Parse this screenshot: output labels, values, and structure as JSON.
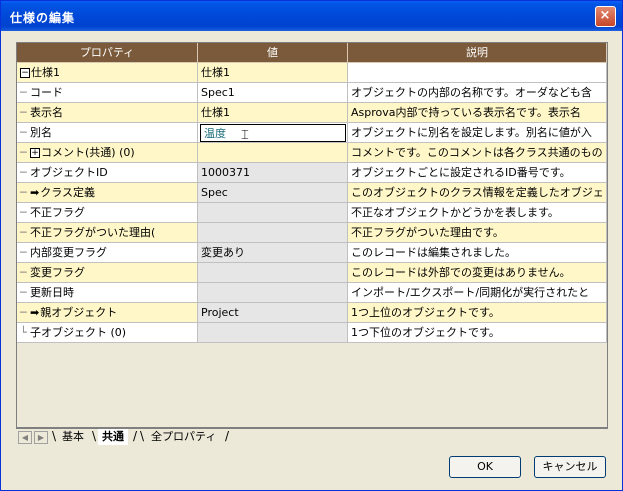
{
  "window": {
    "title": "仕様の編集",
    "close_label": "×"
  },
  "grid": {
    "headers": [
      "プロパティ",
      "値",
      "説明"
    ],
    "rows": [
      {
        "prefix": "",
        "expander": "−",
        "arrow": "",
        "label": "仕様1",
        "value": "仕様1",
        "desc": "",
        "c1": "yellow",
        "c2": "yellow",
        "c3": "white"
      },
      {
        "prefix": "─",
        "expander": "",
        "arrow": "",
        "label": "コード",
        "value": "Spec1",
        "desc": "オブジェクトの内部の名称です。オーダなども含",
        "c1": "white",
        "c2": "white",
        "c3": "white"
      },
      {
        "prefix": "─",
        "expander": "",
        "arrow": "",
        "label": "表示名",
        "value": "仕様1",
        "desc": "Asprova内部で持っている表示名です。表示名",
        "c1": "yellow",
        "c2": "yellow",
        "c3": "yellow"
      },
      {
        "prefix": "─",
        "expander": "",
        "arrow": "",
        "label": "別名",
        "value": "温度",
        "desc": "オブジェクトに別名を設定します。別名に値が入",
        "c1": "white",
        "c2": "white",
        "c3": "white",
        "editing": true
      },
      {
        "prefix": "─",
        "expander": "+",
        "arrow": "",
        "label": "コメント(共通) (0)",
        "value": "",
        "desc": "コメントです。このコメントは各クラス共通のもの",
        "c1": "yellow",
        "c2": "yellow",
        "c3": "yellow"
      },
      {
        "prefix": "─",
        "expander": "",
        "arrow": "",
        "label": "オブジェクトID",
        "value": "1000371",
        "desc": "オブジェクトごとに設定されるID番号です。",
        "c1": "white",
        "c2": "gray",
        "c3": "white"
      },
      {
        "prefix": "─",
        "expander": "",
        "arrow": "➡",
        "label": "クラス定義",
        "value": "Spec",
        "desc": "このオブジェクトのクラス情報を定義したオブジェ",
        "c1": "yellow",
        "c2": "gray",
        "c3": "yellow"
      },
      {
        "prefix": "─",
        "expander": "",
        "arrow": "",
        "label": "不正フラグ",
        "value": "",
        "desc": "不正なオブジェクトかどうかを表します。",
        "c1": "white",
        "c2": "gray",
        "c3": "white"
      },
      {
        "prefix": "─",
        "expander": "",
        "arrow": "",
        "label": "不正フラグがついた理由(",
        "value": "",
        "desc": "不正フラグがついた理由です。",
        "c1": "yellow",
        "c2": "gray",
        "c3": "yellow"
      },
      {
        "prefix": "─",
        "expander": "",
        "arrow": "",
        "label": "内部変更フラグ",
        "value": "変更あり",
        "desc": "このレコードは編集されました。",
        "c1": "white",
        "c2": "gray",
        "c3": "white"
      },
      {
        "prefix": "─",
        "expander": "",
        "arrow": "",
        "label": "変更フラグ",
        "value": "",
        "desc": "このレコードは外部での変更はありません。",
        "c1": "yellow",
        "c2": "gray",
        "c3": "yellow"
      },
      {
        "prefix": "─",
        "expander": "",
        "arrow": "",
        "label": "更新日時",
        "value": "",
        "desc": "インポート/エクスポート/同期化が実行されたと",
        "c1": "white",
        "c2": "gray",
        "c3": "white"
      },
      {
        "prefix": "─",
        "expander": "",
        "arrow": "➡",
        "label": "親オブジェクト",
        "value": "Project",
        "desc": "1つ上位のオブジェクトです。",
        "c1": "yellow",
        "c2": "gray",
        "c3": "yellow"
      },
      {
        "prefix": "└",
        "expander": "",
        "arrow": "",
        "label": "子オブジェクト (0)",
        "value": "",
        "desc": "1つ下位のオブジェクトです。",
        "c1": "white",
        "c2": "gray",
        "c3": "white"
      }
    ]
  },
  "tabs": [
    {
      "label": "基本",
      "active": false
    },
    {
      "label": "共通",
      "active": true
    },
    {
      "label": "全プロパティ",
      "active": false
    }
  ],
  "buttons": {
    "ok": "OK",
    "cancel": "キャンセル"
  }
}
